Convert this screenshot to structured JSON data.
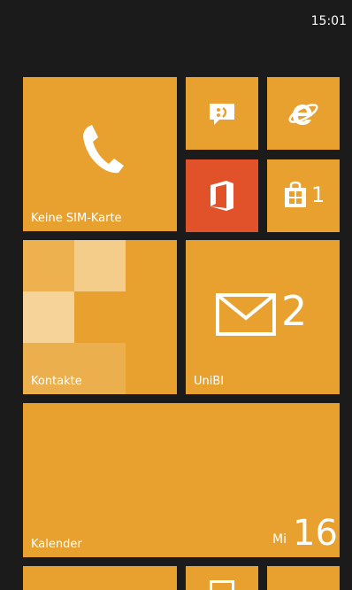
{
  "status_bar": {
    "time": "15:01"
  },
  "colors": {
    "background": "#1b1b1b",
    "accent": "#e8a12e",
    "office_tile": "#e2522a",
    "text": "#ffffff"
  },
  "tiles": {
    "phone": {
      "label": "Keine SIM-Karte",
      "icon": "phone-icon"
    },
    "messaging": {
      "icon": "message-icon"
    },
    "internet_explorer": {
      "icon": "internet-explorer-icon"
    },
    "office": {
      "icon": "office-icon"
    },
    "store": {
      "icon": "store-icon",
      "count": "1"
    },
    "contacts": {
      "label": "Kontakte"
    },
    "mail": {
      "label": "UniBI",
      "icon": "mail-icon",
      "count": "2"
    },
    "calendar": {
      "label": "Kalender",
      "weekday": "Mi",
      "day": "16"
    }
  }
}
